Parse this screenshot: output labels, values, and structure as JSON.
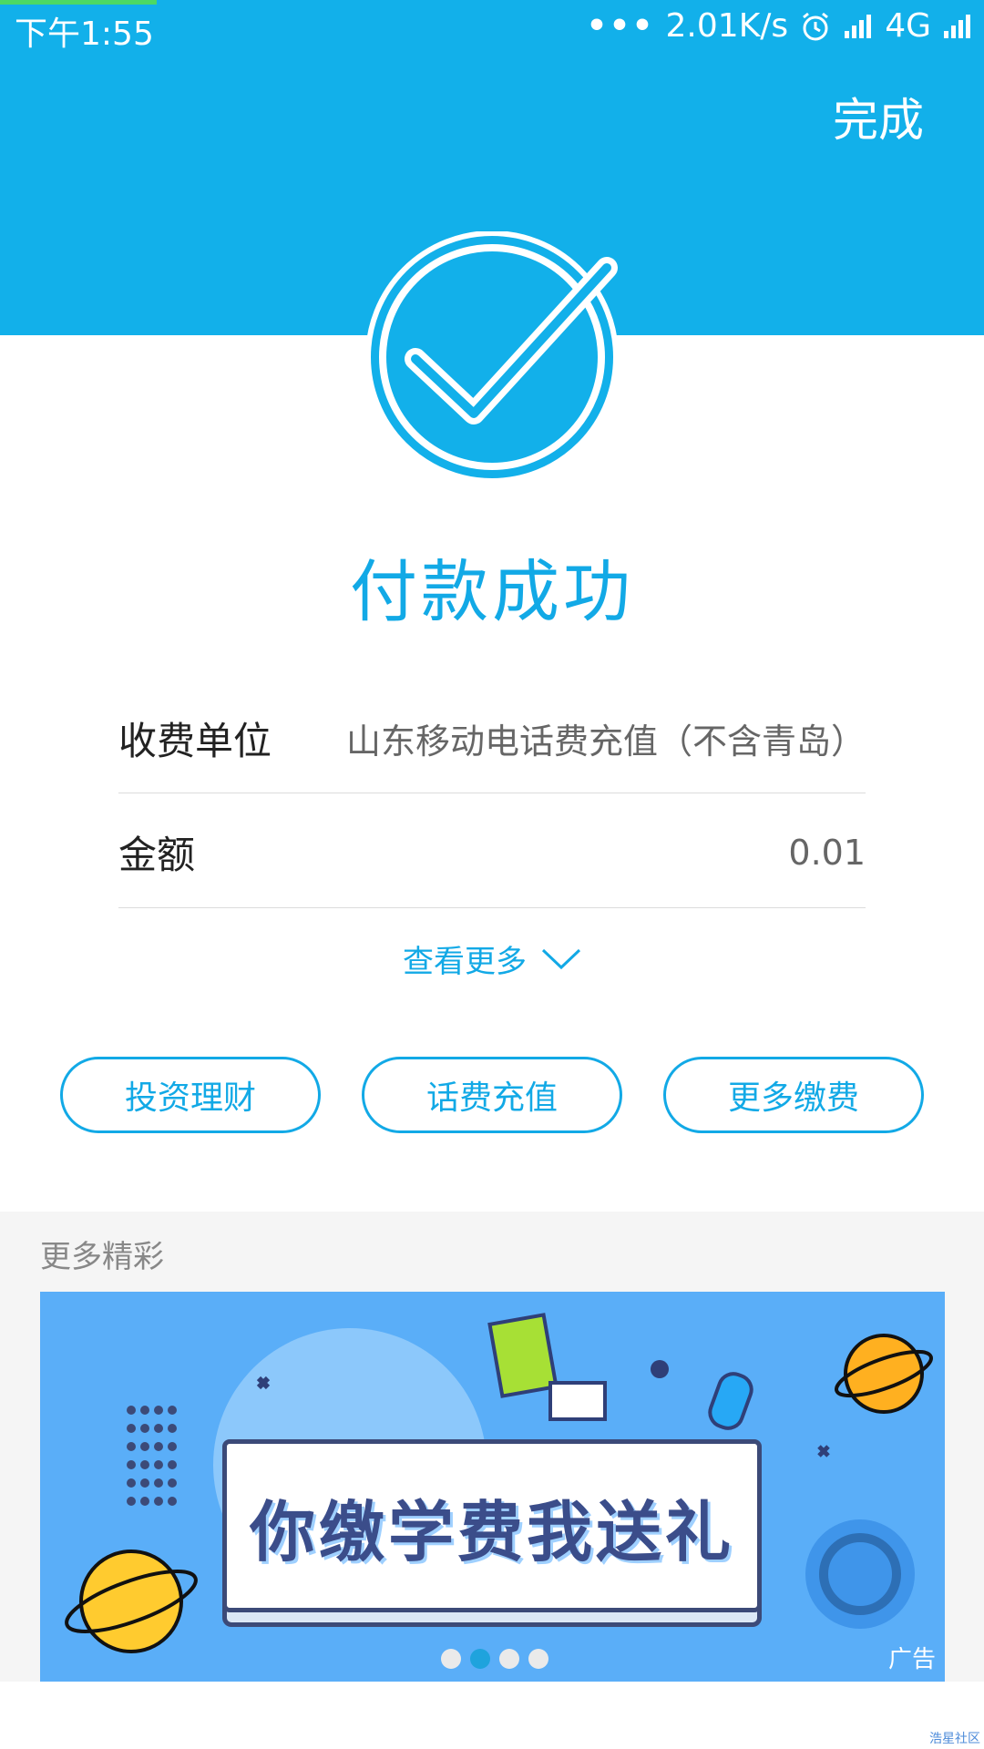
{
  "status_bar": {
    "time": "下午1:55",
    "dots": "•••",
    "net_speed": "2.01K/s",
    "network": "4G"
  },
  "header": {
    "done_label": "完成"
  },
  "result": {
    "title": "付款成功"
  },
  "details": {
    "rows": [
      {
        "label": "收费单位",
        "value": "山东移动电话费充值（不含青岛）"
      },
      {
        "label": "金额",
        "value": "0.01"
      }
    ],
    "more_label": "查看更多"
  },
  "actions": {
    "buttons": [
      {
        "label": "投资理财"
      },
      {
        "label": "话费充值"
      },
      {
        "label": "更多缴费"
      }
    ]
  },
  "more_section": {
    "label": "更多精彩",
    "banner": {
      "text": "你缴学费我送礼",
      "ad_tag": "广告",
      "active_dot": 1,
      "dot_count": 4
    }
  },
  "watermark": "浩星社区",
  "colors": {
    "header_bg": "#12b0ea",
    "accent": "#12a9e6",
    "banner_bg": "#5aaef8"
  },
  "icons": {
    "status": [
      "alarm-icon",
      "signal-icon",
      "signal-icon"
    ],
    "result": "check-circle-icon",
    "toggle": "chevron-down-icon"
  }
}
